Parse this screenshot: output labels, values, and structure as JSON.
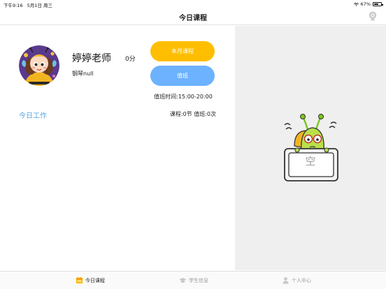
{
  "status_bar": {
    "time": "下午9:16",
    "date": "5月1日 周三",
    "battery": "67%",
    "battery_level": 0.67
  },
  "nav": {
    "title": "今日课程",
    "settings_icon": "camera-settings-icon"
  },
  "teacher": {
    "name": "婷婷老师",
    "score": "0分",
    "instrument": "钢琴null",
    "avatar_icon": "cartoon-bee-girl-avatar"
  },
  "actions": {
    "month_course_label": "本月课程",
    "duty_label": "值班"
  },
  "duty_time": "值班时间:15:00-20:00",
  "today_work_label": "今日工作",
  "summary": "课程:0节 值班:0次",
  "empty_state": {
    "text": "空",
    "icon": "snail-empty-sign-icon"
  },
  "tabs": [
    {
      "label": "今日课程",
      "icon": "calendar-icon",
      "active": true
    },
    {
      "label": "学生信息",
      "icon": "graduation-cap-icon",
      "active": false
    },
    {
      "label": "个人中心",
      "icon": "person-icon",
      "active": false
    }
  ],
  "colors": {
    "primary_yellow": "#ffbe00",
    "primary_blue": "#6cb2ff",
    "link_blue": "#55a7e0",
    "panel_gray": "#efefef"
  }
}
